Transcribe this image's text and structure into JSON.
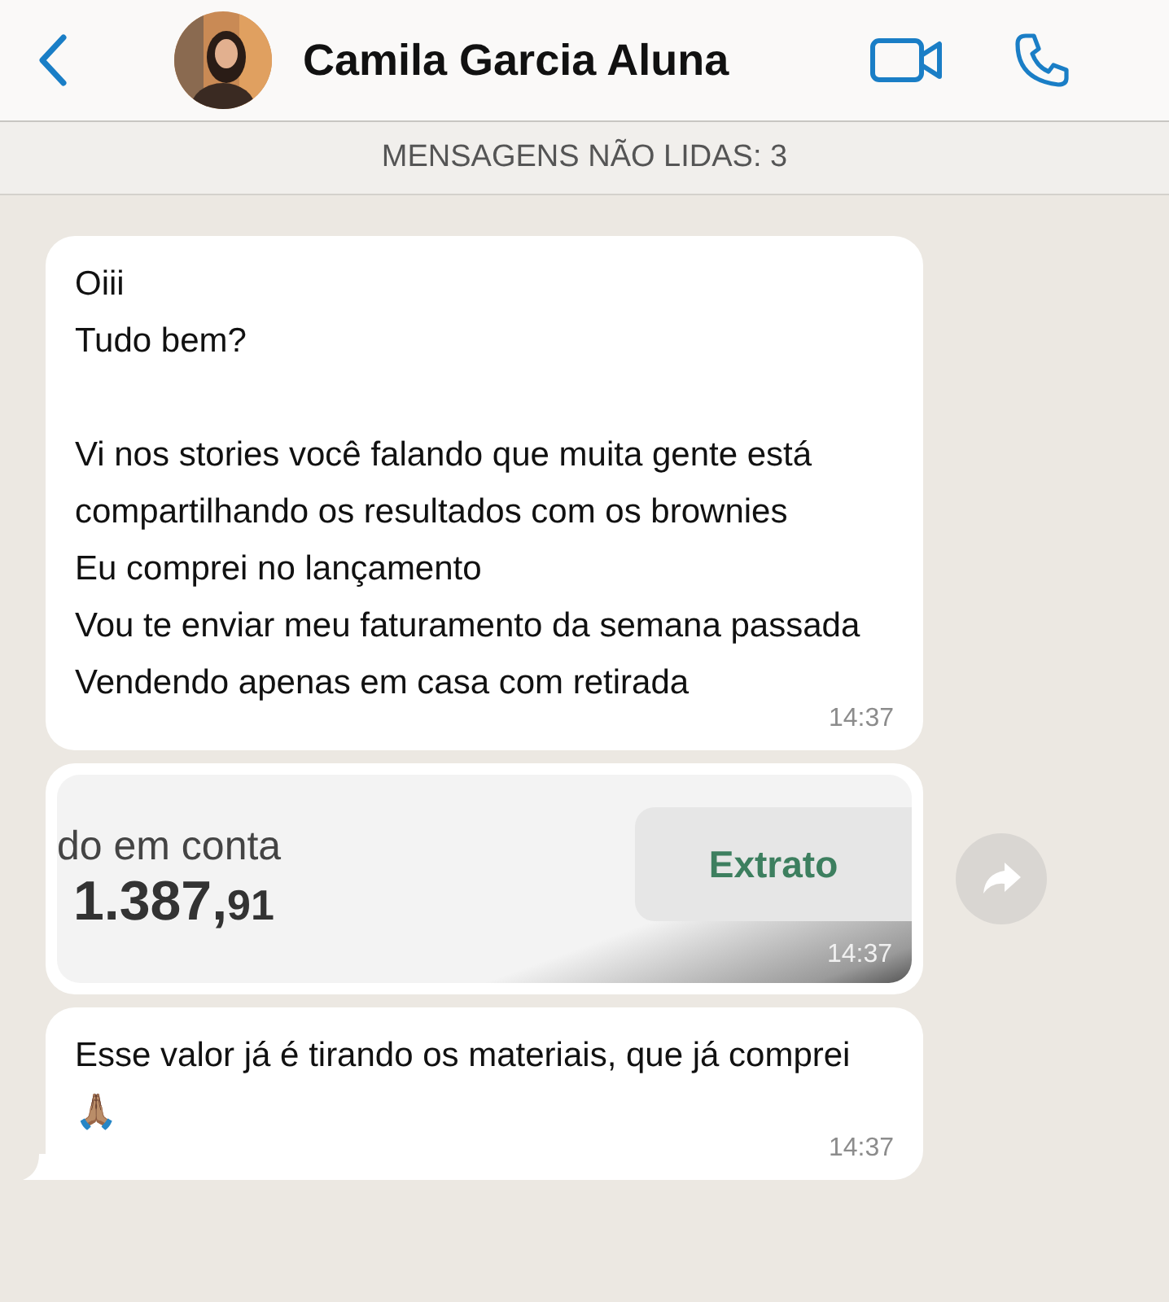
{
  "header": {
    "contact_name": "Camila Garcia Aluna"
  },
  "unread_banner": "MENSAGENS NÃO LIDAS: 3",
  "messages": [
    {
      "kind": "text",
      "text": "Oiii\nTudo bem?\n\nVi nos stories você falando que muita gente está compartilhando os resultados com os brownies\nEu comprei no lançamento\nVou te enviar meu faturamento da semana passada\nVendendo apenas em casa com retirada",
      "time": "14:37",
      "tail": false
    },
    {
      "screenshot": {
        "label": "do em conta",
        "amount_main": "1.387,",
        "amount_cents": "91",
        "button": "Extrato"
      },
      "time": "14:37",
      "tail": false
    },
    {
      "kind": "text",
      "text": "Esse valor já é tirando os materiais, que já comprei 🙏🏽",
      "time": "14:37",
      "tail": true
    }
  ]
}
